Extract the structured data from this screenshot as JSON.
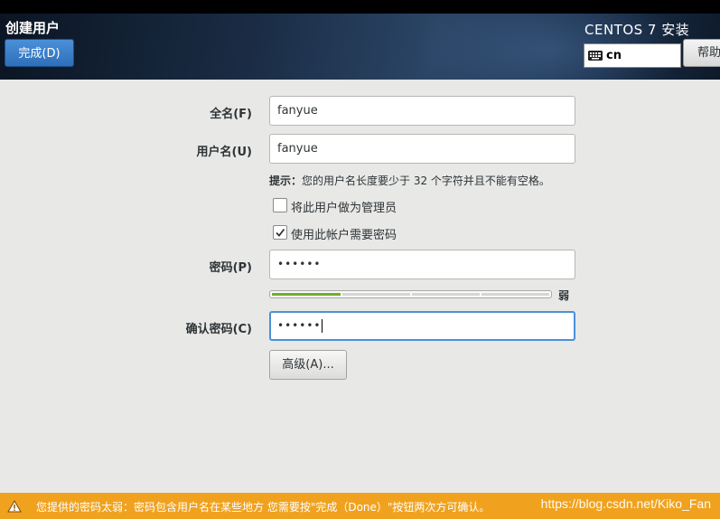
{
  "header": {
    "title": "创建用户",
    "done_label": "完成(D)",
    "install_title": "CENTOS 7 安装",
    "keyboard_layout": "cn",
    "help_label": "帮助"
  },
  "form": {
    "fullname_label": "全名(F)",
    "fullname_value": "fanyue",
    "username_label": "用户名(U)",
    "username_value": "fanyue",
    "hint_prefix": "提示：",
    "hint_text": "您的用户名长度要少于 32 个字符并且不能有空格。",
    "admin_checkbox_label": "将此用户做为管理员",
    "admin_checked": false,
    "require_password_label": "使用此帐户需要密码",
    "require_password_checked": true,
    "password_label": "密码(P)",
    "password_value": "••••••",
    "strength_text": "弱",
    "strength_level": 0.25,
    "confirm_label": "确认密码(C)",
    "confirm_value": "••••••",
    "advanced_label": "高级(A)..."
  },
  "warning": {
    "text": "您提供的密码太弱：密码包含用户名在某些地方 您需要按\"完成（Done）\"按钮两次方可确认。",
    "watermark": "https://blog.csdn.net/Kiko_Fan"
  },
  "colors": {
    "accent": "#4a90d9",
    "warning": "#f0a21f",
    "strength": "#73ad2a"
  }
}
